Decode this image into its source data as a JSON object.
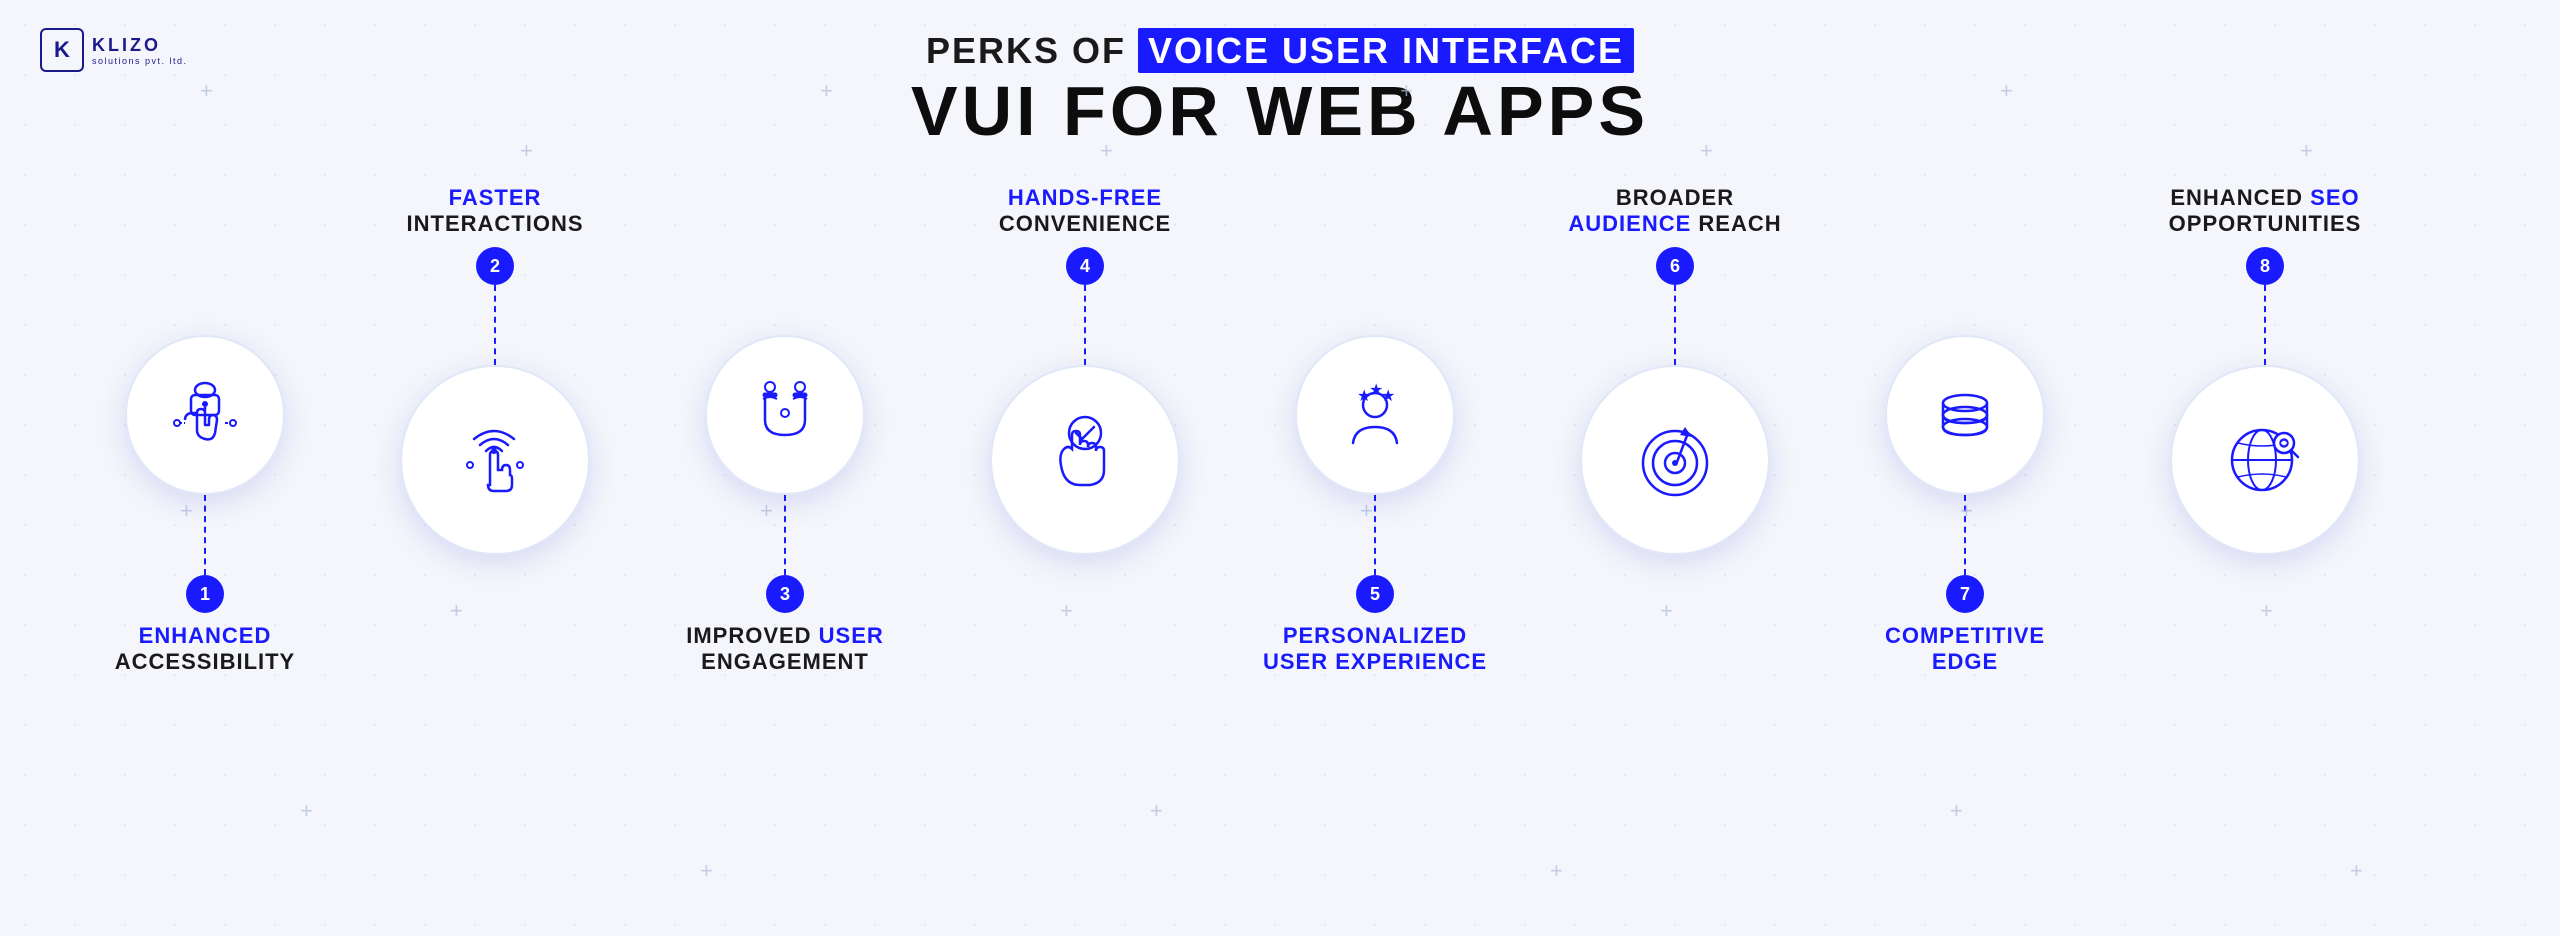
{
  "logo": {
    "k_letter": "K",
    "name": "KLIZO",
    "subtitle": "solutions pvt. ltd."
  },
  "header": {
    "prefix": "PERKS OF",
    "highlight": "VOICE USER INTERFACE",
    "title": "VUI FOR WEB APPS"
  },
  "items": [
    {
      "id": 1,
      "position": "bottom",
      "label_line1": "ENHANCED",
      "label_line2": "ACCESSIBILITY",
      "label_color": "blue",
      "icon": "hand-lock"
    },
    {
      "id": 2,
      "position": "top",
      "label_line1": "FASTER",
      "label_line2": "INTERACTIONS",
      "label_color": "blue",
      "icon": "touch-gesture"
    },
    {
      "id": 3,
      "position": "bottom",
      "label_line1": "IMPROVED USER",
      "label_line2": "ENGAGEMENT",
      "label_color_line1": "black",
      "label_color_line2": "black",
      "label_highlight_word": "USER",
      "icon": "magnet-people"
    },
    {
      "id": 4,
      "position": "top",
      "label_line1": "HANDS-FREE",
      "label_line2": "CONVENIENCE",
      "label_color": "blue",
      "icon": "hand-check"
    },
    {
      "id": 5,
      "position": "bottom",
      "label_line1": "PERSONALIZED",
      "label_line2": "USER EXPERIENCE",
      "label_color": "blue",
      "icon": "person-stars"
    },
    {
      "id": 6,
      "position": "top",
      "label_line1": "BROADER",
      "label_line2": "AUDIENCE REACH",
      "label_color_line1": "black",
      "label_color_line2": "black",
      "label_highlight_word": "AUDIENCE",
      "icon": "target-arrow"
    },
    {
      "id": 7,
      "position": "bottom",
      "label_line1": "COMPETITIVE",
      "label_line2": "EDGE",
      "label_color": "blue",
      "icon": "coins-stack"
    },
    {
      "id": 8,
      "position": "top",
      "label_line1": "ENHANCED SEO",
      "label_line2": "OPPORTUNITIES",
      "label_color_line1": "black",
      "label_color_line2": "black",
      "label_highlight_word": "SEO",
      "icon": "globe-search"
    }
  ],
  "colors": {
    "blue": "#1a1aff",
    "dark": "#0d0d0d",
    "light_blue": "#e0e8f8"
  }
}
